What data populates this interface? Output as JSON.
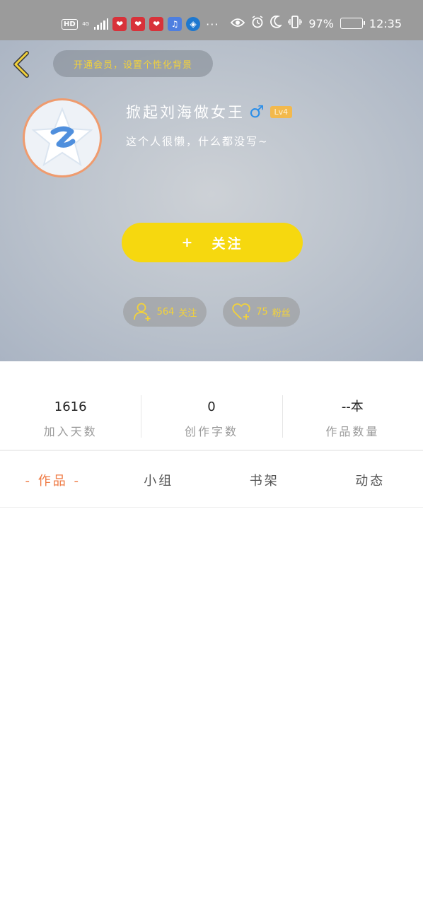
{
  "status_bar": {
    "hd": "HD",
    "network": "4G",
    "more": "···",
    "battery": "97%",
    "time": "12:35",
    "icons": [
      "eye-icon",
      "alarm-icon",
      "moon-icon",
      "vibrate-icon",
      "battery-icon"
    ]
  },
  "header": {
    "member_prompt": "开通会员，设置个性化背景",
    "username": "掀起刘海做女王",
    "gender_symbol": "♂",
    "level": "Lv4",
    "bio": "这个人很懒，什么都没写~",
    "follow_plus": "+",
    "follow_label": "关注",
    "following_count": "564",
    "following_label": "关注",
    "fans_count": "75",
    "fans_label": "粉丝",
    "colors": {
      "accent_yellow": "#f6d80f",
      "avatar_border": "#ef9b6e",
      "gender_blue": "#2c8fe8",
      "level_badge": "#f3b94c"
    }
  },
  "stats": [
    {
      "value": "1616",
      "label": "加入天数"
    },
    {
      "value": "0",
      "label": "创作字数"
    },
    {
      "value": "--本",
      "label": "作品数量"
    }
  ],
  "tabs": [
    {
      "label": "- 作品 -",
      "active": true
    },
    {
      "label": "小组",
      "active": false
    },
    {
      "label": "书架",
      "active": false
    },
    {
      "label": "动态",
      "active": false
    }
  ],
  "tab_active_color": "#ef7b45"
}
